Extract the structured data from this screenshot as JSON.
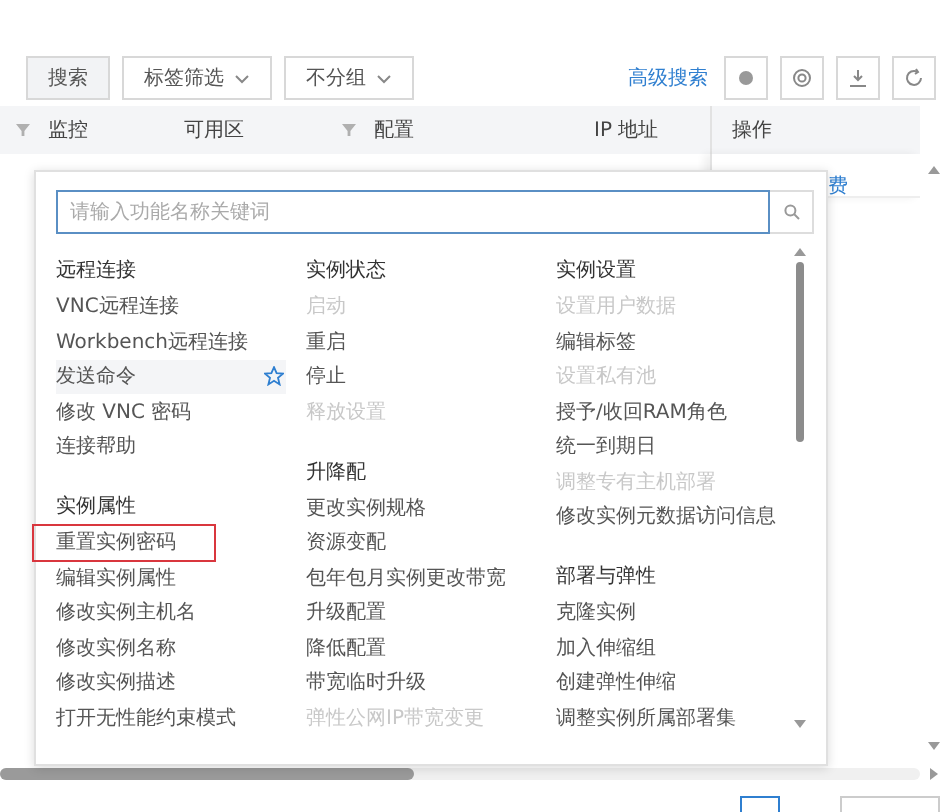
{
  "toolbar": {
    "search_button": "搜索",
    "filters": [
      {
        "label": "标签筛选",
        "kind": "dropdown"
      },
      {
        "label": "不分组",
        "kind": "dropdown"
      }
    ],
    "advanced_search": "高级搜索"
  },
  "table": {
    "columns": [
      {
        "label": "监控",
        "filter": true
      },
      {
        "label": "可用区",
        "filter": false
      },
      {
        "label": "配置",
        "filter": true
      },
      {
        "label": "IP 地址",
        "filter": false
      }
    ],
    "action_column": {
      "label": "操作",
      "row_link": "费"
    }
  },
  "popup": {
    "search": {
      "placeholder": "请输入功能名称关键词"
    },
    "columns": [
      [
        {
          "heading": "远程连接",
          "items": [
            {
              "label": "VNC远程连接",
              "disabled": false,
              "hovered": false,
              "outlined": false
            },
            {
              "label": "Workbench远程连接",
              "disabled": false,
              "hovered": false,
              "outlined": false
            },
            {
              "label": "发送命令",
              "disabled": false,
              "hovered": true,
              "outlined": false
            },
            {
              "label": "修改 VNC 密码",
              "disabled": false,
              "hovered": false,
              "outlined": false
            },
            {
              "label": "连接帮助",
              "disabled": false,
              "hovered": false,
              "outlined": false
            }
          ]
        },
        {
          "heading": "实例属性",
          "items": [
            {
              "label": "重置实例密码",
              "disabled": false,
              "hovered": false,
              "outlined": true
            },
            {
              "label": "编辑实例属性",
              "disabled": false,
              "hovered": false,
              "outlined": false
            },
            {
              "label": "修改实例主机名",
              "disabled": false,
              "hovered": false,
              "outlined": false
            },
            {
              "label": "修改实例名称",
              "disabled": false,
              "hovered": false,
              "outlined": false
            },
            {
              "label": "修改实例描述",
              "disabled": false,
              "hovered": false,
              "outlined": false
            },
            {
              "label": "打开无性能约束模式",
              "disabled": false,
              "hovered": false,
              "outlined": false
            }
          ]
        }
      ],
      [
        {
          "heading": "实例状态",
          "items": [
            {
              "label": "启动",
              "disabled": true,
              "hovered": false,
              "outlined": false
            },
            {
              "label": "重启",
              "disabled": false,
              "hovered": false,
              "outlined": false
            },
            {
              "label": "停止",
              "disabled": false,
              "hovered": false,
              "outlined": false
            },
            {
              "label": "释放设置",
              "disabled": true,
              "hovered": false,
              "outlined": false
            }
          ]
        },
        {
          "heading": "升降配",
          "items": [
            {
              "label": "更改实例规格",
              "disabled": false,
              "hovered": false,
              "outlined": false
            },
            {
              "label": "资源变配",
              "disabled": false,
              "hovered": false,
              "outlined": false
            },
            {
              "label": "包年包月实例更改带宽",
              "disabled": false,
              "hovered": false,
              "outlined": false
            },
            {
              "label": "升级配置",
              "disabled": false,
              "hovered": false,
              "outlined": false
            },
            {
              "label": "降低配置",
              "disabled": false,
              "hovered": false,
              "outlined": false
            },
            {
              "label": "带宽临时升级",
              "disabled": false,
              "hovered": false,
              "outlined": false
            },
            {
              "label": "弹性公网IP带宽变更",
              "disabled": true,
              "hovered": false,
              "outlined": false
            }
          ]
        }
      ],
      [
        {
          "heading": "实例设置",
          "items": [
            {
              "label": "设置用户数据",
              "disabled": true,
              "hovered": false,
              "outlined": false
            },
            {
              "label": "编辑标签",
              "disabled": false,
              "hovered": false,
              "outlined": false
            },
            {
              "label": "设置私有池",
              "disabled": true,
              "hovered": false,
              "outlined": false
            },
            {
              "label": "授予/收回RAM角色",
              "disabled": false,
              "hovered": false,
              "outlined": false
            },
            {
              "label": "统一到期日",
              "disabled": false,
              "hovered": false,
              "outlined": false
            },
            {
              "label": "调整专有主机部署",
              "disabled": true,
              "hovered": false,
              "outlined": false
            },
            {
              "label": "修改实例元数据访问信息",
              "disabled": false,
              "hovered": false,
              "outlined": false
            }
          ]
        },
        {
          "heading": "部署与弹性",
          "items": [
            {
              "label": "克隆实例",
              "disabled": false,
              "hovered": false,
              "outlined": false
            },
            {
              "label": "加入伸缩组",
              "disabled": false,
              "hovered": false,
              "outlined": false
            },
            {
              "label": "创建弹性伸缩",
              "disabled": false,
              "hovered": false,
              "outlined": false
            },
            {
              "label": "调整实例所属部署集",
              "disabled": false,
              "hovered": false,
              "outlined": false
            }
          ]
        }
      ]
    ]
  }
}
